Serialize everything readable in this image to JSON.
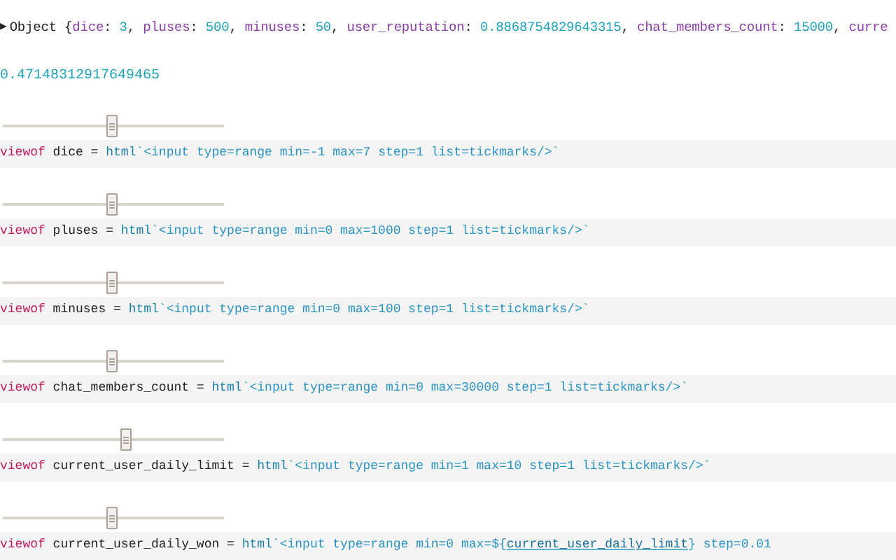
{
  "object_line": {
    "toggle": "▶",
    "tokens": [
      {
        "kind": "plain",
        "text": "Object {"
      },
      {
        "kind": "key",
        "text": "dice"
      },
      {
        "kind": "plain",
        "text": ": "
      },
      {
        "kind": "number",
        "text": "3"
      },
      {
        "kind": "plain",
        "text": ", "
      },
      {
        "kind": "key",
        "text": "pluses"
      },
      {
        "kind": "plain",
        "text": ": "
      },
      {
        "kind": "number",
        "text": "500"
      },
      {
        "kind": "plain",
        "text": ", "
      },
      {
        "kind": "key",
        "text": "minuses"
      },
      {
        "kind": "plain",
        "text": ": "
      },
      {
        "kind": "number",
        "text": "50"
      },
      {
        "kind": "plain",
        "text": ", "
      },
      {
        "kind": "key",
        "text": "user_reputation"
      },
      {
        "kind": "plain",
        "text": ": "
      },
      {
        "kind": "number",
        "text": "0.8868754829643315"
      },
      {
        "kind": "plain",
        "text": ", "
      },
      {
        "kind": "key",
        "text": "chat_members_count"
      },
      {
        "kind": "plain",
        "text": ": "
      },
      {
        "kind": "number",
        "text": "15000"
      },
      {
        "kind": "plain",
        "text": ", "
      },
      {
        "kind": "key",
        "text": "curre"
      }
    ]
  },
  "result_value": "0.47148312917649465",
  "cells": [
    {
      "slider": {
        "level": 0.5
      },
      "code": [
        {
          "kind": "keyword",
          "text": "viewof"
        },
        {
          "kind": "plain",
          "text": " dice = "
        },
        {
          "kind": "function",
          "text": "html"
        },
        {
          "kind": "string",
          "text": "`<input type=range min=-1 max=7 step=1 list=tickmarks/>`"
        }
      ]
    },
    {
      "slider": {
        "level": 0.5
      },
      "code": [
        {
          "kind": "keyword",
          "text": "viewof"
        },
        {
          "kind": "plain",
          "text": " pluses = "
        },
        {
          "kind": "function",
          "text": "html"
        },
        {
          "kind": "string",
          "text": "`<input type=range min=0 max=1000 step=1 list=tickmarks/>`"
        }
      ]
    },
    {
      "slider": {
        "level": 0.5
      },
      "code": [
        {
          "kind": "keyword",
          "text": "viewof"
        },
        {
          "kind": "plain",
          "text": " minuses = "
        },
        {
          "kind": "function",
          "text": "html"
        },
        {
          "kind": "string",
          "text": "`<input type=range min=0 max=100 step=1 list=tickmarks/>`"
        }
      ]
    },
    {
      "slider": {
        "level": 0.5
      },
      "code": [
        {
          "kind": "keyword",
          "text": "viewof"
        },
        {
          "kind": "plain",
          "text": " chat_members_count = "
        },
        {
          "kind": "function",
          "text": "html"
        },
        {
          "kind": "string",
          "text": "`<input type=range min=0 max=30000 step=1 list=tickmarks/>`"
        }
      ]
    },
    {
      "slider": {
        "level": 0.56
      },
      "code": [
        {
          "kind": "keyword",
          "text": "viewof"
        },
        {
          "kind": "plain",
          "text": " current_user_daily_limit = "
        },
        {
          "kind": "function",
          "text": "html"
        },
        {
          "kind": "string",
          "text": "`<input type=range min=1 max=10 step=1 list=tickmarks/>`"
        }
      ]
    },
    {
      "slider": {
        "level": 0.5
      },
      "code": [
        {
          "kind": "keyword",
          "text": "viewof"
        },
        {
          "kind": "plain",
          "text": " current_user_daily_won = "
        },
        {
          "kind": "function",
          "text": "html"
        },
        {
          "kind": "string",
          "text": "`<input type=range min=0 max=${"
        },
        {
          "kind": "reference",
          "text": "current_user_daily_limit"
        },
        {
          "kind": "string",
          "text": "} step=0.01"
        }
      ]
    }
  ]
}
